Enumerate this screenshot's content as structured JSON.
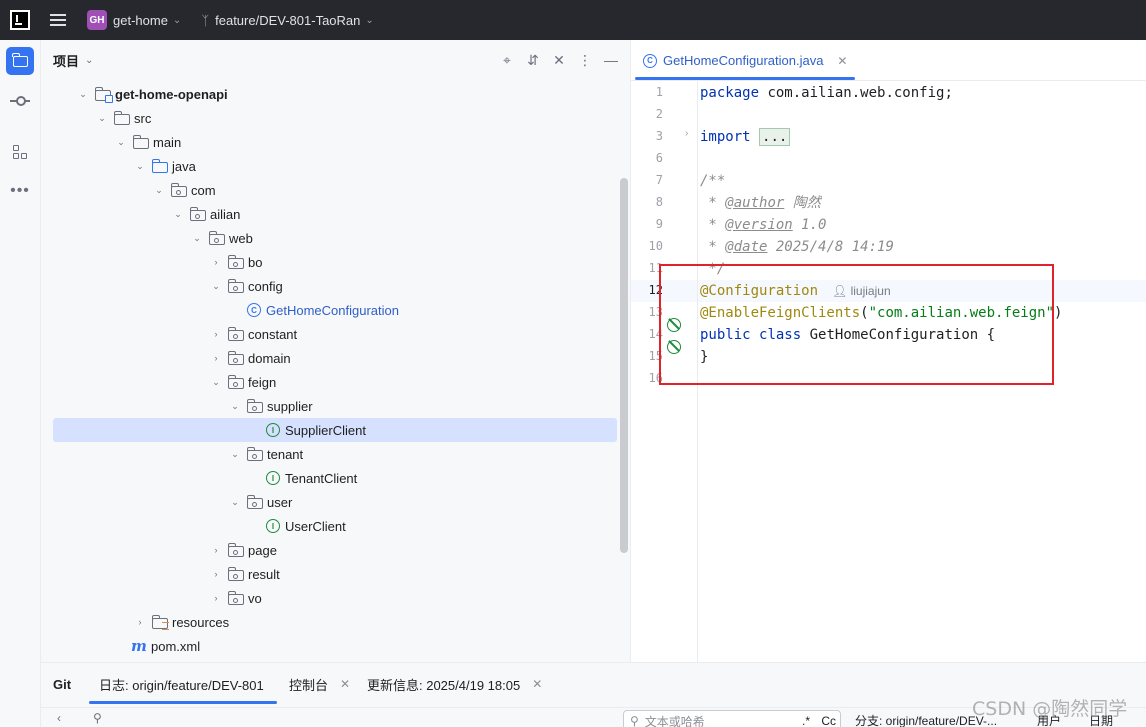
{
  "titlebar": {
    "project_badge": "GH",
    "project_name": "get-home",
    "branch": "feature/DEV-801-TaoRan"
  },
  "project_panel": {
    "title": "项目",
    "tree": [
      {
        "label": "get-home-openapi",
        "depth": 0,
        "expanded": true,
        "icon": "module-folder-icon",
        "bold": true
      },
      {
        "label": "src",
        "depth": 1,
        "expanded": true,
        "icon": "folder-icon"
      },
      {
        "label": "main",
        "depth": 2,
        "expanded": true,
        "icon": "folder-icon"
      },
      {
        "label": "java",
        "depth": 3,
        "expanded": true,
        "icon": "source-root-icon"
      },
      {
        "label": "com",
        "depth": 4,
        "expanded": true,
        "icon": "package-icon"
      },
      {
        "label": "ailian",
        "depth": 5,
        "expanded": true,
        "icon": "package-icon"
      },
      {
        "label": "web",
        "depth": 6,
        "expanded": true,
        "icon": "package-icon"
      },
      {
        "label": "bo",
        "depth": 7,
        "expanded": false,
        "icon": "package-icon"
      },
      {
        "label": "config",
        "depth": 7,
        "expanded": true,
        "icon": "package-icon"
      },
      {
        "label": "GetHomeConfiguration",
        "depth": 8,
        "leaf": true,
        "icon": "class-icon",
        "blue": true
      },
      {
        "label": "constant",
        "depth": 7,
        "expanded": false,
        "icon": "package-icon"
      },
      {
        "label": "domain",
        "depth": 7,
        "expanded": false,
        "icon": "package-icon"
      },
      {
        "label": "feign",
        "depth": 7,
        "expanded": true,
        "icon": "package-icon"
      },
      {
        "label": "supplier",
        "depth": 8,
        "expanded": true,
        "icon": "package-icon"
      },
      {
        "label": "SupplierClient",
        "depth": 9,
        "leaf": true,
        "icon": "interface-icon",
        "selected": true
      },
      {
        "label": "tenant",
        "depth": 8,
        "expanded": true,
        "icon": "package-icon"
      },
      {
        "label": "TenantClient",
        "depth": 9,
        "leaf": true,
        "icon": "interface-icon"
      },
      {
        "label": "user",
        "depth": 8,
        "expanded": true,
        "icon": "package-icon"
      },
      {
        "label": "UserClient",
        "depth": 9,
        "leaf": true,
        "icon": "interface-icon"
      },
      {
        "label": "page",
        "depth": 7,
        "expanded": false,
        "icon": "package-icon"
      },
      {
        "label": "result",
        "depth": 7,
        "expanded": false,
        "icon": "package-icon"
      },
      {
        "label": "vo",
        "depth": 7,
        "expanded": false,
        "icon": "package-icon"
      },
      {
        "label": "resources",
        "depth": 3,
        "expanded": false,
        "icon": "resources-folder-icon"
      },
      {
        "label": "pom.xml",
        "depth": 2,
        "leaf": true,
        "icon": "maven-icon"
      }
    ]
  },
  "editor": {
    "tab_name": "GetHomeConfiguration.java",
    "line_numbers": [
      "1",
      "2",
      "3",
      "6",
      "7",
      "8",
      "9",
      "10",
      "11",
      "12",
      "13",
      "14",
      "15",
      "16"
    ],
    "current_line": "12",
    "code": {
      "l1_kw": "package",
      "l1_rest": " com.ailian.web.config;",
      "l3_kw": "import",
      "l3_fold": "...",
      "l7": "/**",
      "l8_prefix": " * ",
      "l8_tag": "@author",
      "l8_val": " 陶然",
      "l9_prefix": " * ",
      "l9_tag": "@version",
      "l9_val": " 1.0",
      "l10_prefix": " * ",
      "l10_tag": "@date",
      "l10_val": " 2025/4/8 14:19",
      "l11": " */",
      "l12_ann": "@Configuration",
      "l12_author": "liujiajun",
      "l13_ann": "@EnableFeignClients",
      "l13_open": "(",
      "l13_str": "\"com.ailian.web.feign\"",
      "l13_close": ")",
      "l14_kw1": "public",
      "l14_kw2": "class",
      "l14_rest": " GetHomeConfiguration {",
      "l15": "}"
    }
  },
  "bottom": {
    "git_label": "Git",
    "log_tab": "日志: origin/feature/DEV-801",
    "console_tab": "控制台",
    "update_tab": "更新信息: 2025/4/19 18:05",
    "search_placeholder": "文本或哈希",
    "regex_label": ".*",
    "case_label": "Cc",
    "branch_filter": "分支: origin/feature/DEV-...",
    "user_filter": "用户",
    "date_filter": "日期"
  },
  "watermark": "CSDN @陶然同学"
}
